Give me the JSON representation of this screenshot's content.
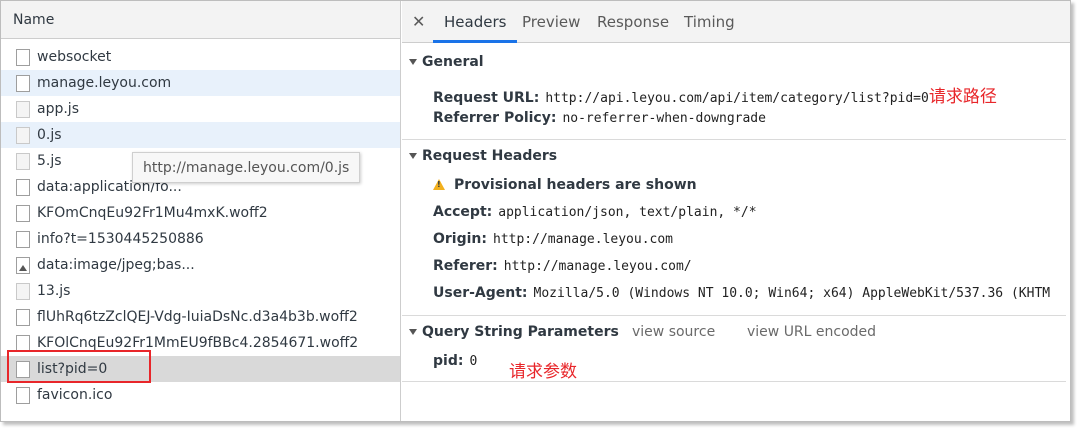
{
  "left_pane": {
    "header": "Name",
    "requests": [
      {
        "name": "websocket",
        "icon": "file-icon",
        "style": "plain"
      },
      {
        "name": "manage.leyou.com",
        "icon": "file-icon",
        "style": "hl"
      },
      {
        "name": "app.js",
        "icon": "file-icon",
        "style": "plain"
      },
      {
        "name": "0.js",
        "icon": "file-icon",
        "style": "hl"
      },
      {
        "name": "5.js",
        "icon": "file-icon",
        "style": "plain"
      },
      {
        "name": "data:application/fo...",
        "icon": "file-icon",
        "style": "plain"
      },
      {
        "name": "KFOmCnqEu92Fr1Mu4mxK.woff2",
        "icon": "file-icon",
        "style": "plain"
      },
      {
        "name": "info?t=1530445250886",
        "icon": "file-icon",
        "style": "plain"
      },
      {
        "name": "data:image/jpeg;bas...",
        "icon": "image-icon",
        "style": "plain"
      },
      {
        "name": "13.js",
        "icon": "file-icon",
        "style": "plain"
      },
      {
        "name": "flUhRq6tzZclQEJ-Vdg-IuiaDsNc.d3a4b3b.woff2",
        "icon": "file-icon",
        "style": "plain"
      },
      {
        "name": "KFOlCnqEu92Fr1MmEU9fBBc4.2854671.woff2",
        "icon": "file-icon",
        "style": "plain"
      },
      {
        "name": "list?pid=0",
        "icon": "file-icon",
        "style": "sel"
      },
      {
        "name": "favicon.ico",
        "icon": "file-icon",
        "style": "plain"
      }
    ],
    "tooltip": "http://manage.leyou.com/0.js"
  },
  "tabs": {
    "close_icon": "close-icon",
    "items": [
      "Headers",
      "Preview",
      "Response",
      "Timing"
    ],
    "active": "Headers"
  },
  "general": {
    "title": "General",
    "request_url_key": "Request URL:",
    "request_url_value": "http://api.leyou.com/api/item/category/list?pid=0",
    "request_url_note": "请求路径",
    "referrer_policy_key": "Referrer Policy:",
    "referrer_policy_value": "no-referrer-when-downgrade"
  },
  "request_headers": {
    "title": "Request Headers",
    "warning": "Provisional headers are shown",
    "accept_key": "Accept:",
    "accept_value": "application/json, text/plain, */*",
    "origin_key": "Origin:",
    "origin_value": "http://manage.leyou.com",
    "referer_key": "Referer:",
    "referer_value": "http://manage.leyou.com/",
    "ua_key": "User-Agent:",
    "ua_value": "Mozilla/5.0 (Windows NT 10.0; Win64; x64) AppleWebKit/537.36 (KHTM"
  },
  "query_params": {
    "title": "Query String Parameters",
    "view_source": "view source",
    "view_url_encoded": "view URL encoded",
    "pid_key": "pid:",
    "pid_value": "0",
    "note": "请求参数"
  },
  "colors": {
    "accent": "#1a73e8",
    "annotation_red": "#e8262a",
    "warning_yellow": "#f2b01e"
  }
}
